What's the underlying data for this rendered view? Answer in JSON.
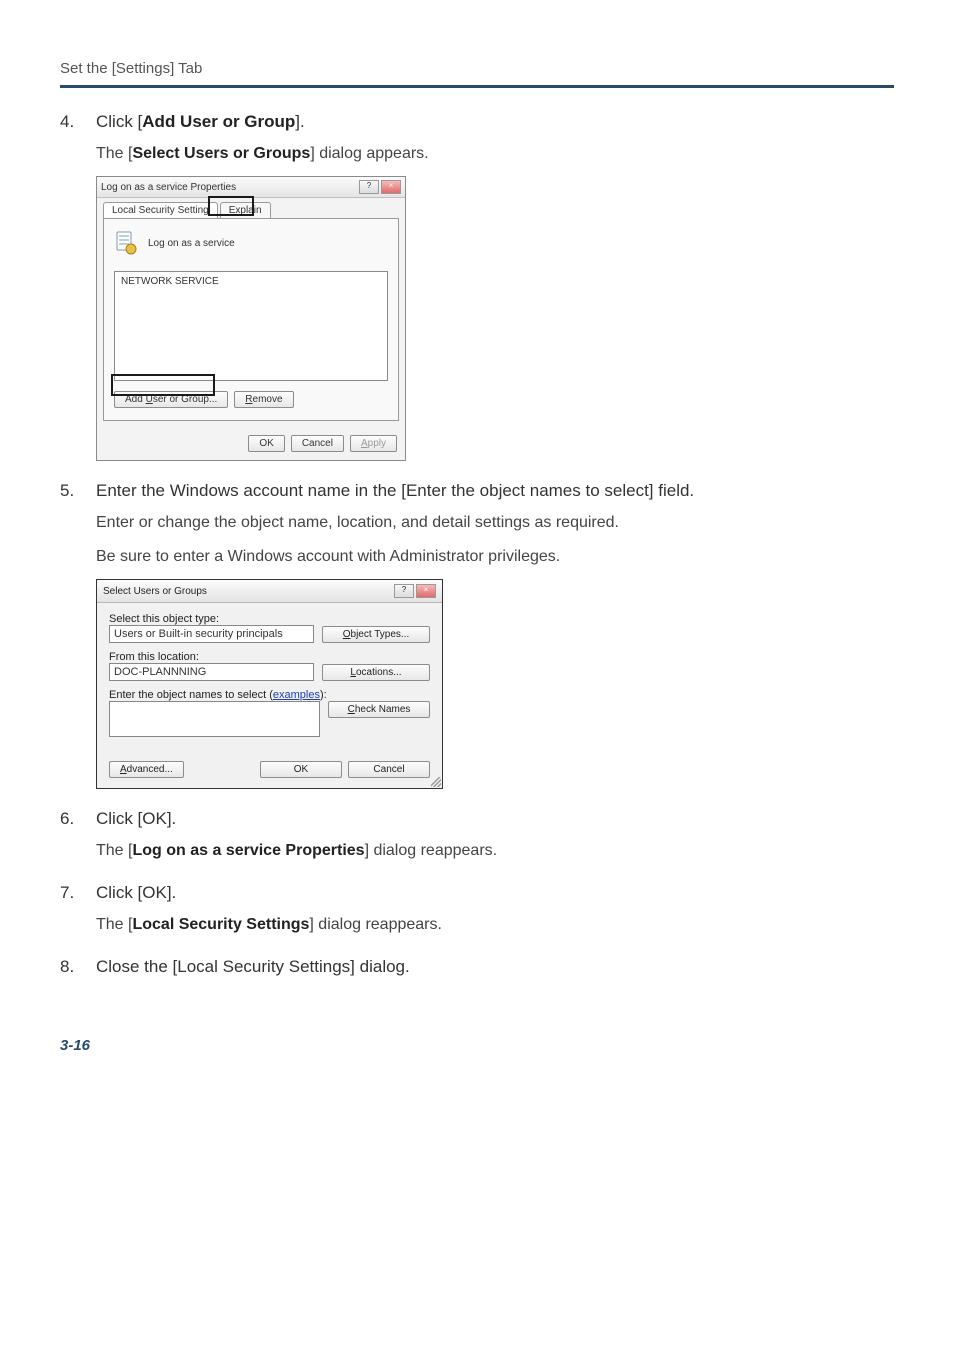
{
  "header": {
    "title": "Set the [Settings] Tab"
  },
  "steps": {
    "s4": {
      "num": "4.",
      "title_pre": "Click [",
      "title_bold": "Add User or Group",
      "title_post": "].",
      "body_pre": "The [",
      "body_bold": "Select Users or Groups",
      "body_post": "] dialog appears."
    },
    "s5": {
      "num": "5.",
      "title": "Enter the Windows account name in the [Enter the object names to select] field.",
      "body1": "Enter or change the object name, location, and detail settings as required.",
      "body2": "Be sure to enter a Windows account with Administrator privileges."
    },
    "s6": {
      "num": "6.",
      "title": "Click [OK].",
      "body_pre": "The [",
      "body_bold": "Log on as a service Properties",
      "body_post": "] dialog reappears."
    },
    "s7": {
      "num": "7.",
      "title": "Click [OK].",
      "body_pre": "The [",
      "body_bold": "Local Security Settings",
      "body_post": "] dialog reappears."
    },
    "s8": {
      "num": "8.",
      "title": "Close the [Local Security Settings] dialog."
    }
  },
  "dlg1": {
    "title": "Log on as a service Properties",
    "tab1": "Local Security Setting",
    "tab2_ul": "E",
    "tab2_rest": "xplain",
    "policy": "Log on as a service",
    "list_item": "NETWORK SERVICE",
    "add_pre": "Add ",
    "add_ul": "U",
    "add_post": "ser or Group...",
    "remove_ul": "R",
    "remove_post": "emove",
    "ok": "OK",
    "cancel": "Cancel",
    "apply_ul": "A",
    "apply_post": "pply"
  },
  "dlg2": {
    "title": "Select Users or Groups",
    "lbl_objtype_ul": "S",
    "lbl_objtype_post": "elect this object type:",
    "objtype_val": "Users or Built-in security principals",
    "btn_objtypes_ul": "O",
    "btn_objtypes_post": "bject Types...",
    "lbl_from_ul": "F",
    "lbl_from_post": "rom this location:",
    "from_val": "DOC-PLANNNING",
    "btn_locations_ul": "L",
    "btn_locations_post": "ocations...",
    "lbl_enter_ul": "E",
    "lbl_enter_mid": "nter the object names to select (",
    "lbl_enter_examples": "examples",
    "lbl_enter_end": "):",
    "btn_check_ul": "C",
    "btn_check_post": "heck Names",
    "btn_advanced_ul": "A",
    "btn_advanced_post": "dvanced...",
    "ok": "OK",
    "cancel": "Cancel"
  },
  "page_num": "3-16"
}
